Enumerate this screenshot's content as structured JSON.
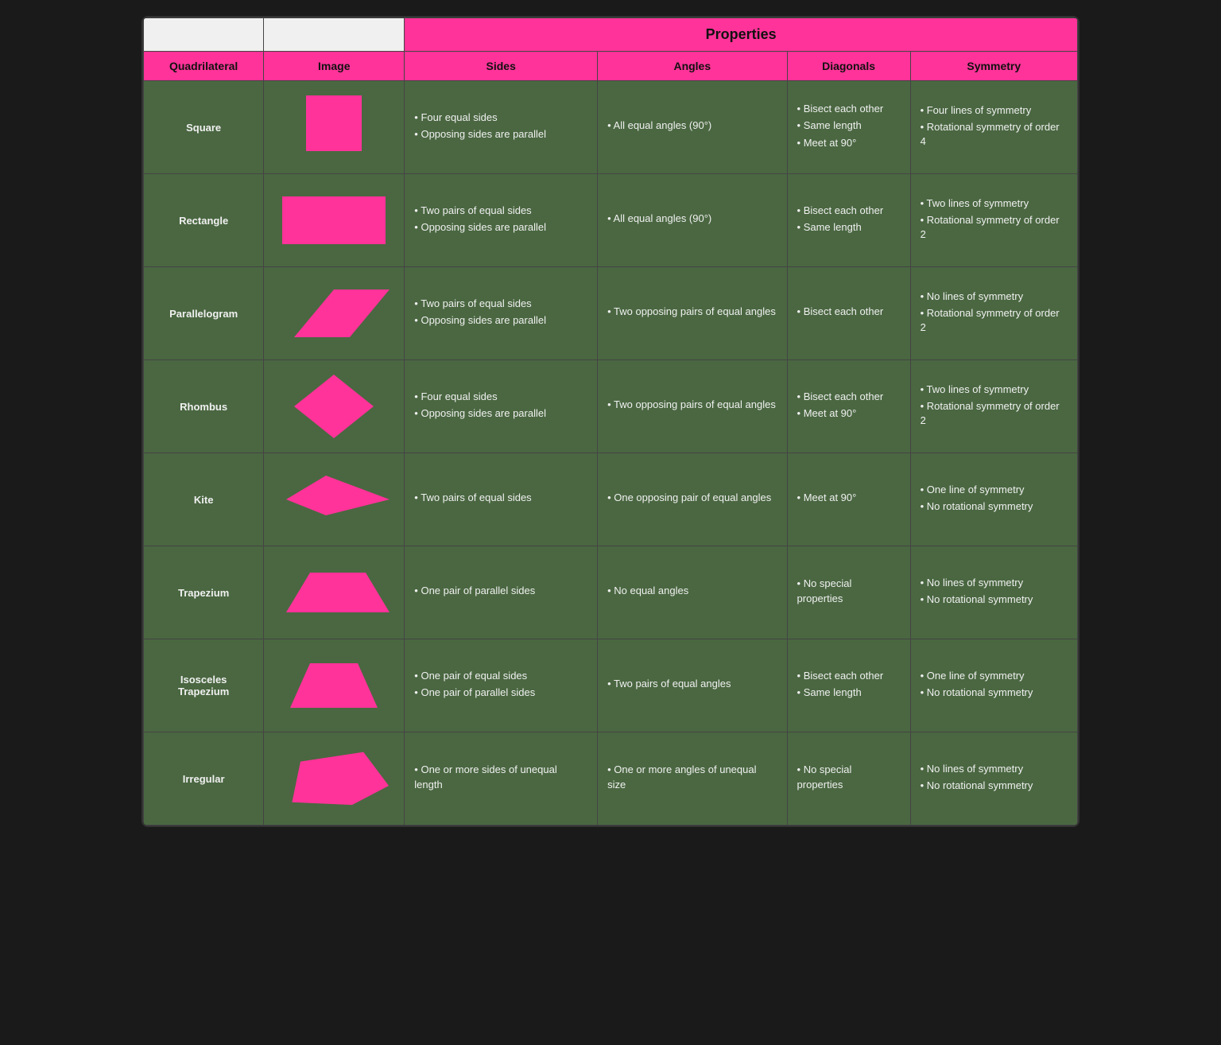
{
  "table": {
    "properties_label": "Properties",
    "columns": {
      "quadrilateral": "Quadrilateral",
      "image": "Image",
      "sides": "Sides",
      "angles": "Angles",
      "diagonals": "Diagonals",
      "symmetry": "Symmetry"
    },
    "rows": [
      {
        "name": "Square",
        "shape": "square",
        "sides": [
          "Four equal sides",
          "Opposing sides are parallel"
        ],
        "angles": [
          "All equal angles (90°)"
        ],
        "diagonals": [
          "Bisect each other",
          "Same length",
          "Meet at 90°"
        ],
        "symmetry": [
          "Four lines of symmetry",
          "Rotational symmetry of order 4"
        ]
      },
      {
        "name": "Rectangle",
        "shape": "rectangle",
        "sides": [
          "Two pairs of equal sides",
          "Opposing sides are parallel"
        ],
        "angles": [
          "All equal angles (90°)"
        ],
        "diagonals": [
          "Bisect each other",
          "Same length"
        ],
        "symmetry": [
          "Two lines of symmetry",
          "Rotational symmetry of order 2"
        ]
      },
      {
        "name": "Parallelogram",
        "shape": "parallelogram",
        "sides": [
          "Two pairs of equal sides",
          "Opposing sides are parallel"
        ],
        "angles": [
          "Two opposing pairs of equal angles"
        ],
        "diagonals": [
          "Bisect each other"
        ],
        "symmetry": [
          "No lines of symmetry",
          "Rotational symmetry of order 2"
        ]
      },
      {
        "name": "Rhombus",
        "shape": "rhombus",
        "sides": [
          "Four equal sides",
          "Opposing sides are parallel"
        ],
        "angles": [
          "Two opposing pairs of equal angles"
        ],
        "diagonals": [
          "Bisect each other",
          "Meet at 90°"
        ],
        "symmetry": [
          "Two lines of symmetry",
          "Rotational symmetry of order 2"
        ]
      },
      {
        "name": "Kite",
        "shape": "kite",
        "sides": [
          "Two pairs of equal sides"
        ],
        "angles": [
          "One opposing pair of equal angles"
        ],
        "diagonals": [
          "Meet at 90°"
        ],
        "symmetry": [
          "One line of symmetry",
          "No rotational symmetry"
        ]
      },
      {
        "name": "Trapezium",
        "shape": "trapezium",
        "sides": [
          "One pair of parallel sides"
        ],
        "angles": [
          "No equal angles"
        ],
        "diagonals": [
          "No special properties"
        ],
        "symmetry": [
          "No lines of symmetry",
          "No rotational symmetry"
        ]
      },
      {
        "name": "Isosceles Trapezium",
        "shape": "isosceles_trapezium",
        "sides": [
          "One pair of equal sides",
          "One pair of parallel sides"
        ],
        "angles": [
          "Two pairs of equal angles"
        ],
        "diagonals": [
          "Bisect each other",
          "Same length"
        ],
        "symmetry": [
          "One line of symmetry",
          "No rotational symmetry"
        ]
      },
      {
        "name": "Irregular",
        "shape": "irregular",
        "sides": [
          "One or more sides of unequal length"
        ],
        "angles": [
          "One or more angles of unequal size"
        ],
        "diagonals": [
          "No special properties"
        ],
        "symmetry": [
          "No lines of symmetry",
          "No rotational symmetry"
        ]
      }
    ]
  }
}
